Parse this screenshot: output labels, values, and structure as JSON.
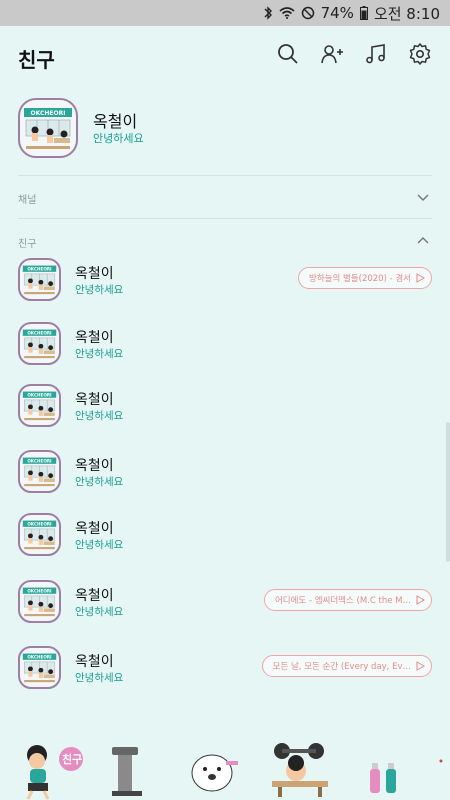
{
  "status": {
    "battery": "74%",
    "time": "오전 8:10"
  },
  "header": {
    "title": "친구"
  },
  "icons": {
    "search": "search-icon",
    "add_friend": "add-friend-icon",
    "music": "music-icon",
    "settings": "settings-icon"
  },
  "my_profile": {
    "name": "옥철이",
    "message": "안녕하세요",
    "avatar_text": "OKCHEORI"
  },
  "sections": {
    "channel": "채널",
    "friends": "친구"
  },
  "friends": [
    {
      "name": "옥철이",
      "message": "안녕하세요",
      "music": "방하늘의 별들(2020) - 경서"
    },
    {
      "name": "옥철이",
      "message": "안녕하세요",
      "music": ""
    },
    {
      "name": "옥철이",
      "message": "안녕하세요",
      "music": ""
    },
    {
      "name": "옥철이",
      "message": "안녕하세요",
      "music": ""
    },
    {
      "name": "옥철이",
      "message": "안녕하세요",
      "music": ""
    },
    {
      "name": "옥철이",
      "message": "안녕하세요",
      "music": "어디에도 - 엠씨더맥스 (M.C the M…"
    },
    {
      "name": "옥철이",
      "message": "안녕하세요",
      "music": "모든 날, 모든 순간 (Every day, Ev…"
    }
  ],
  "bottom_badge": "친구",
  "colors": {
    "background": "#e6f6f4",
    "accent": "#1a9e91",
    "music_pill": "#e48b8b",
    "avatar_border": "#9c7fa4"
  }
}
